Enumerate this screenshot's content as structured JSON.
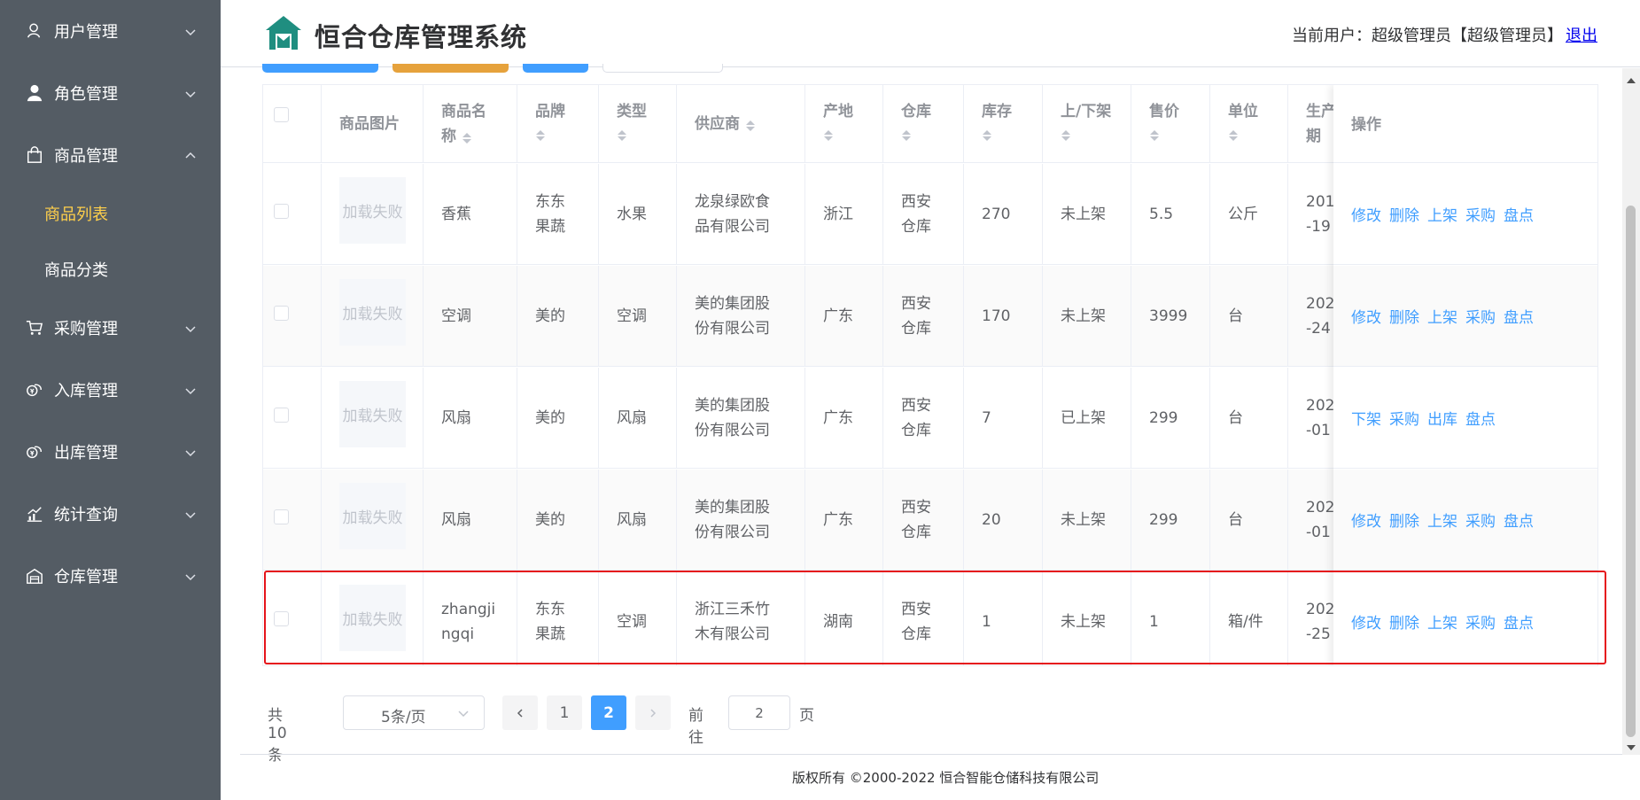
{
  "colors": {
    "sidebar_bg": "#545c64",
    "sidebar_active": "#ffd04b",
    "link": "#409eff",
    "highlight_border": "#e5141b",
    "logo": "#1f8e80"
  },
  "header": {
    "title": "恒合仓库管理系统",
    "current_user": "当前用户：超级管理员【超级管理员】",
    "logout": "退出"
  },
  "sidebar": {
    "items": [
      {
        "label": "用户管理",
        "icon": "user-outline-icon",
        "expanded": false
      },
      {
        "label": "角色管理",
        "icon": "user-solid-icon",
        "expanded": false
      },
      {
        "label": "商品管理",
        "icon": "shopping-bag-icon",
        "expanded": true
      },
      {
        "label": "采购管理",
        "icon": "shopping-cart-icon",
        "expanded": false
      },
      {
        "label": "入库管理",
        "icon": "coins-icon",
        "expanded": false
      },
      {
        "label": "出库管理",
        "icon": "coins-icon",
        "expanded": false
      },
      {
        "label": "统计查询",
        "icon": "chart-line-icon",
        "expanded": false
      },
      {
        "label": "仓库管理",
        "icon": "warehouse-icon",
        "expanded": false
      }
    ],
    "subitems": [
      {
        "label": "商品列表",
        "active": true
      },
      {
        "label": "商品分类",
        "active": false
      }
    ]
  },
  "table": {
    "columns": [
      "商品图片",
      "商品名称",
      "品牌",
      "类型",
      "供应商",
      "产地",
      "仓库",
      "库存",
      "上/下架",
      "售价",
      "单位",
      "生产日期",
      "操作"
    ],
    "columns_display": {
      "name_1": "商品名",
      "name_2": "称",
      "date_1": "生产",
      "date_2": "期"
    },
    "rows": [
      {
        "image": "加载失败",
        "name": "香蕉",
        "brand": "东东果蔬",
        "type": "水果",
        "supplier": "龙泉绿欧食品有限公司",
        "origin": "浙江",
        "warehouse": "西安仓库",
        "stock": "270",
        "status": "未上架",
        "price": "5.5",
        "unit": "公斤",
        "date_1": "201",
        "date_2": "-19",
        "actions": [
          "修改",
          "删除",
          "上架",
          "采购",
          "盘点"
        ]
      },
      {
        "image": "加载失败",
        "name": "空调",
        "brand": "美的",
        "type": "空调",
        "supplier": "美的集团股份有限公司",
        "origin": "广东",
        "warehouse": "西安仓库",
        "stock": "170",
        "status": "未上架",
        "price": "3999",
        "unit": "台",
        "date_1": "202",
        "date_2": "-24",
        "actions": [
          "修改",
          "删除",
          "上架",
          "采购",
          "盘点"
        ]
      },
      {
        "image": "加载失败",
        "name": "风扇",
        "brand": "美的",
        "type": "风扇",
        "supplier": "美的集团股份有限公司",
        "origin": "广东",
        "warehouse": "西安仓库",
        "stock": "7",
        "status": "已上架",
        "price": "299",
        "unit": "台",
        "date_1": "202",
        "date_2": "-01",
        "actions": [
          "下架",
          "采购",
          "出库",
          "盘点"
        ]
      },
      {
        "image": "加载失败",
        "name": "风扇",
        "brand": "美的",
        "type": "风扇",
        "supplier": "美的集团股份有限公司",
        "origin": "广东",
        "warehouse": "西安仓库",
        "stock": "20",
        "status": "未上架",
        "price": "299",
        "unit": "台",
        "date_1": "202",
        "date_2": "-01",
        "actions": [
          "修改",
          "删除",
          "上架",
          "采购",
          "盘点"
        ]
      },
      {
        "image": "加载失败",
        "name": "zhangjingqi",
        "brand": "东东果蔬",
        "type": "空调",
        "supplier": "浙江三禾竹木有限公司",
        "origin": "湖南",
        "warehouse": "西安仓库",
        "stock": "1",
        "status": "未上架",
        "price": "1",
        "unit": "箱/件",
        "date_1": "202",
        "date_2": "-25",
        "actions": [
          "修改",
          "删除",
          "上架",
          "采购",
          "盘点"
        ]
      }
    ]
  },
  "pagination": {
    "total": "共 10 条",
    "page_size": "5条/页",
    "pages": [
      "1",
      "2"
    ],
    "current_page": "2",
    "goto_label": "前往",
    "goto_value": "2",
    "page_suffix": "页"
  },
  "footer": {
    "copyright": "版权所有 ©2000-2022  恒合智能仓储科技有限公司"
  }
}
